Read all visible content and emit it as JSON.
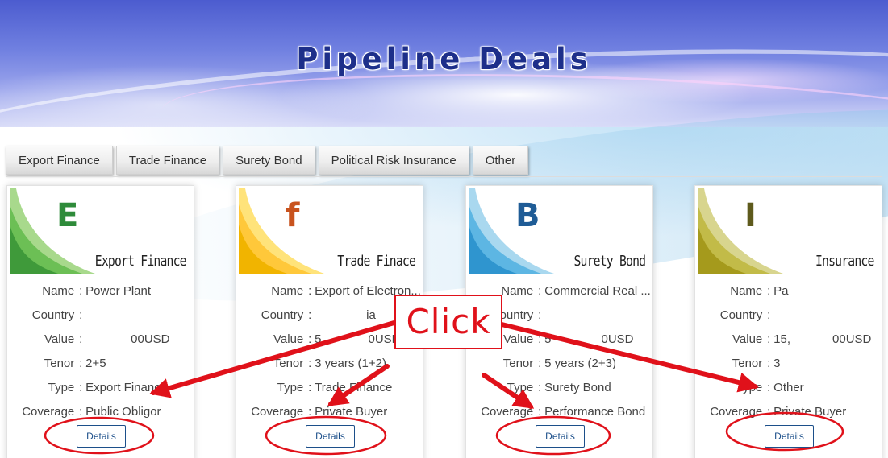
{
  "banner": {
    "title": "Pipeline Deals"
  },
  "tabs": [
    {
      "label": "Export Finance"
    },
    {
      "label": "Trade Finance"
    },
    {
      "label": "Surety Bond"
    },
    {
      "label": "Political Risk Insurance"
    },
    {
      "label": "Other"
    }
  ],
  "field_labels": {
    "name": "Name",
    "country": "Country",
    "value": "Value",
    "tenor": "Tenor",
    "type": "Type",
    "coverage": "Coverage",
    "separator": ":"
  },
  "cards": [
    {
      "letter": "E",
      "heading": "Export Finance",
      "color_light": "#a8d98c",
      "color_dark": "#3f9a3a",
      "letter_color": "#2e8b3a",
      "name": "Power Plant",
      "country": "",
      "value": "00USD",
      "value_prefix": "",
      "tenor": "2+5",
      "type": "Export Finance",
      "coverage": "Public Obligor",
      "details_label": "Details"
    },
    {
      "letter": "f",
      "heading": "Trade Finace",
      "color_light": "#ffe37a",
      "color_dark": "#f1b400",
      "letter_color": "#c8531e",
      "name": "Export of Electron...",
      "country": "ia",
      "value": "0USD",
      "value_prefix": "5",
      "tenor": "3 years (1+2)",
      "type": "Trade Finance",
      "coverage": "Private Buyer",
      "details_label": "Details"
    },
    {
      "letter": "B",
      "heading": "Surety Bond",
      "color_light": "#a9d8ef",
      "color_dark": "#2f95cf",
      "letter_color": "#1f5c96",
      "name": "Commercial Real ...",
      "country": "",
      "value": "0USD",
      "value_prefix": "5",
      "tenor": "5 years (2+3)",
      "type": "Surety Bond",
      "coverage": "Performance Bond",
      "details_label": "Details"
    },
    {
      "letter": "I",
      "heading": "Insurance",
      "color_light": "#d8d58e",
      "color_dark": "#a59a1c",
      "letter_color": "#5e5a1c",
      "name": "Pa",
      "country": "",
      "value": "00USD",
      "value_prefix": "15,",
      "tenor": "3",
      "type": "Other",
      "coverage": "Private Buyer",
      "details_label": "Details"
    }
  ],
  "annotation": {
    "click_label": "Click",
    "color": "#e0111a"
  }
}
